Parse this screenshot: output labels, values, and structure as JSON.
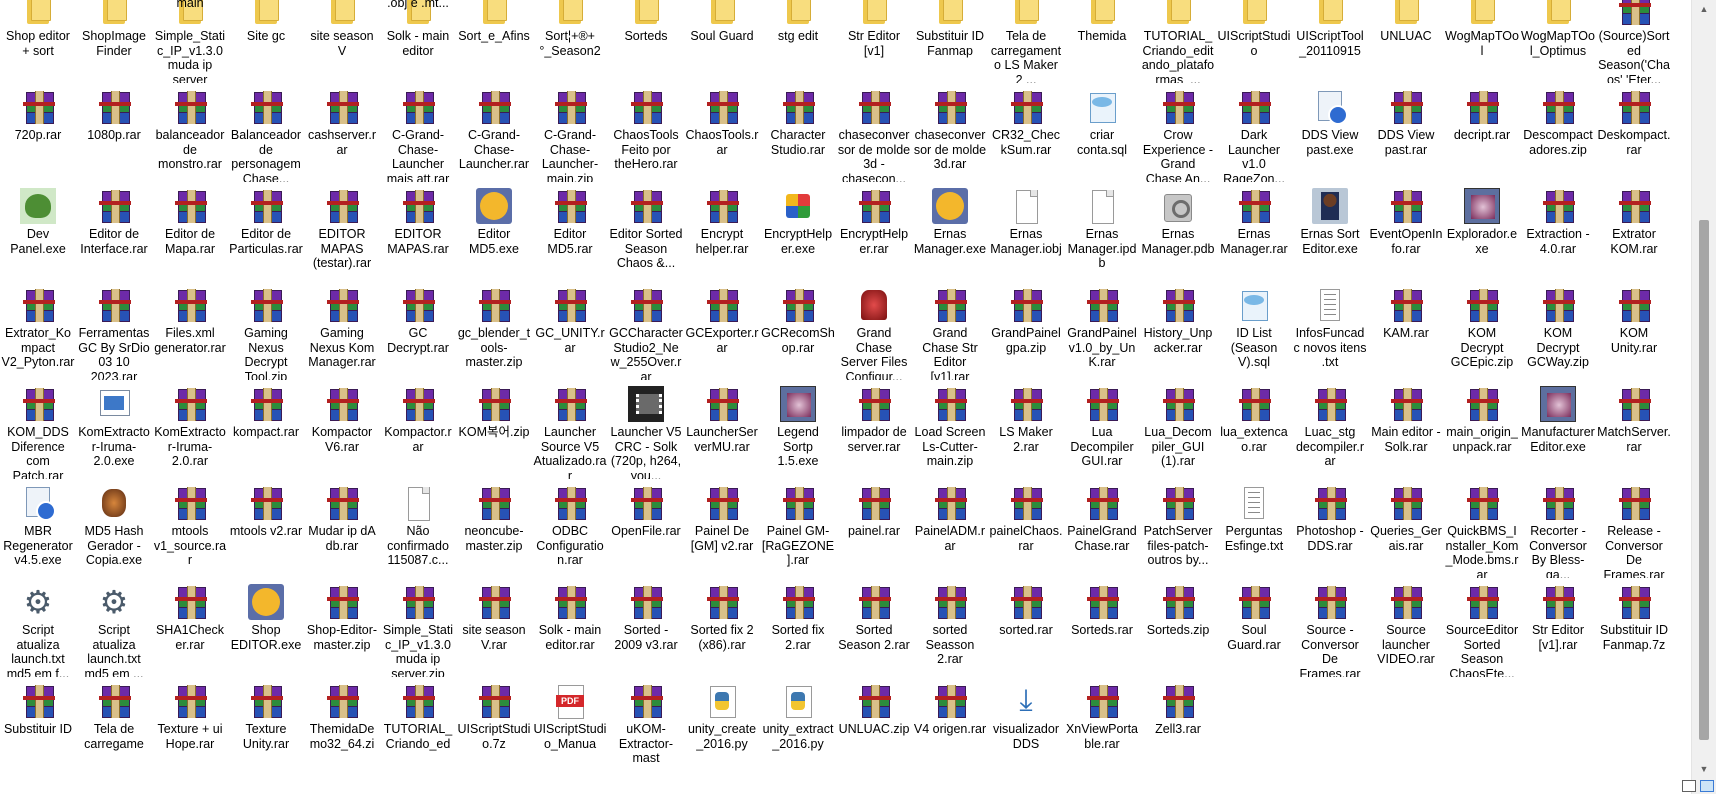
{
  "window": {
    "title": ""
  },
  "scrollbar": {
    "up": "▲",
    "down": "▼"
  },
  "header_row": [
    "main",
    ".obj e .mt..."
  ],
  "files": [
    {
      "name": "Shop editor + sort",
      "icon": "folder"
    },
    {
      "name": "ShopImage Finder",
      "icon": "folder"
    },
    {
      "name": "Simple_Static_IP_v1.3.0 muda ip server",
      "icon": "folder"
    },
    {
      "name": "Site gc",
      "icon": "folder"
    },
    {
      "name": "site season V",
      "icon": "folder"
    },
    {
      "name": "Solk - main editor",
      "icon": "folder"
    },
    {
      "name": "Sort_e_Afins",
      "icon": "folder"
    },
    {
      "name": "Sort¦+®+°_Season2",
      "icon": "folder"
    },
    {
      "name": "Sorteds",
      "icon": "folder"
    },
    {
      "name": "Soul Guard",
      "icon": "folder"
    },
    {
      "name": "stg edit",
      "icon": "folder"
    },
    {
      "name": "Str Editor [v1]",
      "icon": "folder"
    },
    {
      "name": "Substituir ID Fanmap",
      "icon": "folder"
    },
    {
      "name": "Tela de carregamento LS Maker 2 ...",
      "icon": "folder"
    },
    {
      "name": "Themida",
      "icon": "folder"
    },
    {
      "name": "TUTORIAL_Criando_editando_plataformas_...",
      "icon": "folder"
    },
    {
      "name": "UIScriptStudio",
      "icon": "folder"
    },
    {
      "name": "UIScriptTool_20110915",
      "icon": "folder"
    },
    {
      "name": "UNLUAC",
      "icon": "folder"
    },
    {
      "name": "WogMapTOol",
      "icon": "folder"
    },
    {
      "name": "WogMapTOol_Optimus",
      "icon": "folder"
    },
    {
      "name": "(Source)Sorted Season('Chaos' 'Eter...",
      "icon": "rar"
    },
    {
      "name": "720p.rar",
      "icon": "rar"
    },
    {
      "name": "1080p.rar",
      "icon": "rar"
    },
    {
      "name": "balanceador de monstro.rar",
      "icon": "rar"
    },
    {
      "name": "Balanceador de personagem Chase...",
      "icon": "rar"
    },
    {
      "name": "cashserver.rar",
      "icon": "rar"
    },
    {
      "name": "C-Grand-Chase-Launcher mais att.rar",
      "icon": "rar"
    },
    {
      "name": "C-Grand-Chase-Launcher.rar",
      "icon": "rar"
    },
    {
      "name": "C-Grand-Chase-Launcher-main.zip",
      "icon": "rar"
    },
    {
      "name": "ChaosTools Feito por theHero.rar",
      "icon": "rar"
    },
    {
      "name": "ChaosTools.rar",
      "icon": "rar"
    },
    {
      "name": "Character Studio.rar",
      "icon": "rar"
    },
    {
      "name": "chaseconversor de molde 3d - chasecon...",
      "icon": "rar"
    },
    {
      "name": "chaseconversor de molde 3d.rar",
      "icon": "rar"
    },
    {
      "name": "CR32_CheckSum.rar",
      "icon": "rar"
    },
    {
      "name": "criar conta.sql",
      "icon": "sql"
    },
    {
      "name": "Crow Experience - Grand Chase An...",
      "icon": "rar"
    },
    {
      "name": "Dark Launcher v1.0 RageZon...",
      "icon": "rar"
    },
    {
      "name": "DDS View past.exe",
      "icon": "dds"
    },
    {
      "name": "DDS View past.rar",
      "icon": "rar"
    },
    {
      "name": "decript.rar",
      "icon": "rar"
    },
    {
      "name": "Descompactadores.zip",
      "icon": "rar"
    },
    {
      "name": "Deskompact.rar",
      "icon": "rar"
    },
    {
      "name": "Dev Panel.exe",
      "icon": "frog"
    },
    {
      "name": "Editor de Interface.rar",
      "icon": "rar"
    },
    {
      "name": "Editor de Mapa.rar",
      "icon": "rar"
    },
    {
      "name": "Editor de Particulas.rar",
      "icon": "rar"
    },
    {
      "name": "EDITOR MAPAS (testar).rar",
      "icon": "rar"
    },
    {
      "name": "EDITOR MAPAS.rar",
      "icon": "rar"
    },
    {
      "name": "Editor MD5.exe",
      "icon": "exe"
    },
    {
      "name": "Editor MD5.rar",
      "icon": "rar"
    },
    {
      "name": "Editor Sorted Season Chaos &...",
      "icon": "rar"
    },
    {
      "name": "Encrypt helper.rar",
      "icon": "rar"
    },
    {
      "name": "EncryptHelper.exe",
      "icon": "mod"
    },
    {
      "name": "EncryptHelper.rar",
      "icon": "rar"
    },
    {
      "name": "Ernas Manager.exe",
      "icon": "exe"
    },
    {
      "name": "Ernas Manager.iobj",
      "icon": "blank"
    },
    {
      "name": "Ernas Manager.ipdb",
      "icon": "blank"
    },
    {
      "name": "Ernas Manager.pdb",
      "icon": "script"
    },
    {
      "name": "Ernas Manager.rar",
      "icon": "rar"
    },
    {
      "name": "Ernas Sort Editor.exe",
      "icon": "avatar"
    },
    {
      "name": "EventOpenInfo.rar",
      "icon": "rar"
    },
    {
      "name": "Explorador.exe",
      "icon": "image"
    },
    {
      "name": "Extraction - 4.0.rar",
      "icon": "rar"
    },
    {
      "name": "Extrator KOM.rar",
      "icon": "rar"
    },
    {
      "name": "Extrator_Kompact V2_Pyton.rar",
      "icon": "rar"
    },
    {
      "name": "Ferramentas GC By SrDio 03 10 2023.rar",
      "icon": "rar"
    },
    {
      "name": "Files.xml generator.rar",
      "icon": "rar"
    },
    {
      "name": "Gaming Nexus Decrypt Tool.zip",
      "icon": "rar"
    },
    {
      "name": "Gaming Nexus Kom Manager.rar",
      "icon": "rar"
    },
    {
      "name": "GC Decrypt.rar",
      "icon": "rar"
    },
    {
      "name": "gc_blender_tools-master.zip",
      "icon": "rar"
    },
    {
      "name": "GC_UNITY.rar",
      "icon": "rar"
    },
    {
      "name": "GCCharacterStudio2_New_255Over.rar",
      "icon": "rar"
    },
    {
      "name": "GCExporter.rar",
      "icon": "rar"
    },
    {
      "name": "GCRecomShop.rar",
      "icon": "rar"
    },
    {
      "name": "Grand Chase Server Files Configur...",
      "icon": "red"
    },
    {
      "name": "Grand Chase Str Editor [v1].rar",
      "icon": "rar"
    },
    {
      "name": "GrandPainel gpa.zip",
      "icon": "rar"
    },
    {
      "name": "GrandPainelv1.0_by_UnK.rar",
      "icon": "rar"
    },
    {
      "name": "History_Unpacker.rar",
      "icon": "rar"
    },
    {
      "name": "ID List (Season V).sql",
      "icon": "sql"
    },
    {
      "name": "InfosFuncadc novos itens .txt",
      "icon": "text"
    },
    {
      "name": "KAM.rar",
      "icon": "rar"
    },
    {
      "name": "KOM Decrypt GCEpic.zip",
      "icon": "rar"
    },
    {
      "name": "KOM Decrypt GCWay.zip",
      "icon": "rar"
    },
    {
      "name": "KOM Unity.rar",
      "icon": "rar"
    },
    {
      "name": "KOM_DDS Diference com Patch.rar",
      "icon": "rar"
    },
    {
      "name": "KomExtractor-Iruma-2.0.exe",
      "icon": "winrun"
    },
    {
      "name": "KomExtractor-Iruma-2.0.rar",
      "icon": "rar"
    },
    {
      "name": "kompact.rar",
      "icon": "rar"
    },
    {
      "name": "Kompactor V6.rar",
      "icon": "rar"
    },
    {
      "name": "Kompactor.rar",
      "icon": "rar"
    },
    {
      "name": "KOM복어.zip",
      "icon": "rar"
    },
    {
      "name": "Launcher Source V5 Atualizado.rar",
      "icon": "rar"
    },
    {
      "name": "Launcher V5 CRC - Solk (720p, h264, you...",
      "icon": "video"
    },
    {
      "name": "LauncherServerMU.rar",
      "icon": "rar"
    },
    {
      "name": "Legend Sortp 1.5.exe",
      "icon": "image"
    },
    {
      "name": "limpador de server.rar",
      "icon": "rar"
    },
    {
      "name": "Load Screen Ls-Cutter-main.zip",
      "icon": "rar"
    },
    {
      "name": "LS Maker 2.rar",
      "icon": "rar"
    },
    {
      "name": "Lua Decompiler GUI.rar",
      "icon": "rar"
    },
    {
      "name": "Lua_Decompiler_GUI (1).rar",
      "icon": "rar"
    },
    {
      "name": "lua_extencao.rar",
      "icon": "rar"
    },
    {
      "name": "Luac_stg decompiler.rar",
      "icon": "rar"
    },
    {
      "name": "Main editor - Solk.rar",
      "icon": "rar"
    },
    {
      "name": "main_origin_unpack.rar",
      "icon": "rar"
    },
    {
      "name": "ManufacturerEditor.exe",
      "icon": "image"
    },
    {
      "name": "MatchServer.rar",
      "icon": "rar"
    },
    {
      "name": "MBR Regenerator v4.5.exe",
      "icon": "dds"
    },
    {
      "name": "MD5 Hash Gerador - Copia.exe",
      "icon": "hash"
    },
    {
      "name": "mtools v1_source.rar",
      "icon": "rar"
    },
    {
      "name": "mtools v2.rar",
      "icon": "rar"
    },
    {
      "name": "Mudar ip dA db.rar",
      "icon": "rar"
    },
    {
      "name": "Não confirmado 115087.c...",
      "icon": "blank"
    },
    {
      "name": "neoncube-master.zip",
      "icon": "rar"
    },
    {
      "name": "ODBC Configuration.rar",
      "icon": "rar"
    },
    {
      "name": "OpenFile.rar",
      "icon": "rar"
    },
    {
      "name": "Painel De [GM] v2.rar",
      "icon": "rar"
    },
    {
      "name": "Painel GM-[RaGEZONE].rar",
      "icon": "rar"
    },
    {
      "name": "painel.rar",
      "icon": "rar"
    },
    {
      "name": "PainelADM.rar",
      "icon": "rar"
    },
    {
      "name": "painelChaos.rar",
      "icon": "rar"
    },
    {
      "name": "PainelGrandChase.rar",
      "icon": "rar"
    },
    {
      "name": "PatchServer files-patch-outros by...",
      "icon": "rar"
    },
    {
      "name": "Perguntas Esfinge.txt",
      "icon": "text"
    },
    {
      "name": "Photoshop - DDS.rar",
      "icon": "rar"
    },
    {
      "name": "Queries_Gerais.rar",
      "icon": "rar"
    },
    {
      "name": "QuickBMS_Installer_Kom_Mode.bms.rar",
      "icon": "rar"
    },
    {
      "name": "Recorter - Conversor By Bless-ga...",
      "icon": "rar"
    },
    {
      "name": "Release - Conversor De Frames.rar",
      "icon": "rar"
    },
    {
      "name": "Script atualiza launch.txt md5 em f...",
      "icon": "gear"
    },
    {
      "name": "Script atualiza launch.txt md5 em ...",
      "icon": "gear"
    },
    {
      "name": "SHA1Checker.rar",
      "icon": "rar"
    },
    {
      "name": "Shop EDITOR.exe",
      "icon": "exe"
    },
    {
      "name": "Shop-Editor-master.zip",
      "icon": "rar"
    },
    {
      "name": "Simple_Static_IP_v1.3.0 muda ip server.zip",
      "icon": "rar"
    },
    {
      "name": "site season V.rar",
      "icon": "rar"
    },
    {
      "name": "Solk - main editor.rar",
      "icon": "rar"
    },
    {
      "name": "Sorted - 2009 v3.rar",
      "icon": "rar"
    },
    {
      "name": "Sorted fix 2 (x86).rar",
      "icon": "rar"
    },
    {
      "name": "Sorted fix 2.rar",
      "icon": "rar"
    },
    {
      "name": "Sorted Season 2.rar",
      "icon": "rar"
    },
    {
      "name": "sorted Seasson 2.rar",
      "icon": "rar"
    },
    {
      "name": "sorted.rar",
      "icon": "rar"
    },
    {
      "name": "Sorteds.rar",
      "icon": "rar"
    },
    {
      "name": "Sorteds.zip",
      "icon": "rar"
    },
    {
      "name": "Soul Guard.rar",
      "icon": "rar"
    },
    {
      "name": "Source - Conversor De Frames.rar",
      "icon": "rar"
    },
    {
      "name": "Source launcher VIDEO.rar",
      "icon": "rar"
    },
    {
      "name": "SourceEditor Sorted Season ChaosEte...",
      "icon": "rar"
    },
    {
      "name": "Str Editor [v1].rar",
      "icon": "rar"
    },
    {
      "name": "Substituir ID Fanmap.7z",
      "icon": "rar"
    },
    {
      "name": "Substituir ID",
      "icon": "rar"
    },
    {
      "name": "Tela de carregame",
      "icon": "rar"
    },
    {
      "name": "Texture + ui Hope.rar",
      "icon": "rar"
    },
    {
      "name": "Texture Unity.rar",
      "icon": "rar"
    },
    {
      "name": "ThemidaDemo32_64.zi",
      "icon": "rar"
    },
    {
      "name": "TUTORIAL_Criando_ed",
      "icon": "rar"
    },
    {
      "name": "UIScriptStudio.7z",
      "icon": "rar"
    },
    {
      "name": "UIScriptStudio_Manua",
      "icon": "pdf"
    },
    {
      "name": "uKOM-Extractor-mast",
      "icon": "rar"
    },
    {
      "name": "unity_create_2016.py",
      "icon": "py"
    },
    {
      "name": "unity_extract_2016.py",
      "icon": "py"
    },
    {
      "name": "UNLUAC.zip",
      "icon": "rar"
    },
    {
      "name": "V4 origen.rar",
      "icon": "rar"
    },
    {
      "name": "visualizador DDS",
      "icon": "dl"
    },
    {
      "name": "XnViewPortable.rar",
      "icon": "rar"
    },
    {
      "name": "Zell3.rar",
      "icon": "rar"
    }
  ]
}
